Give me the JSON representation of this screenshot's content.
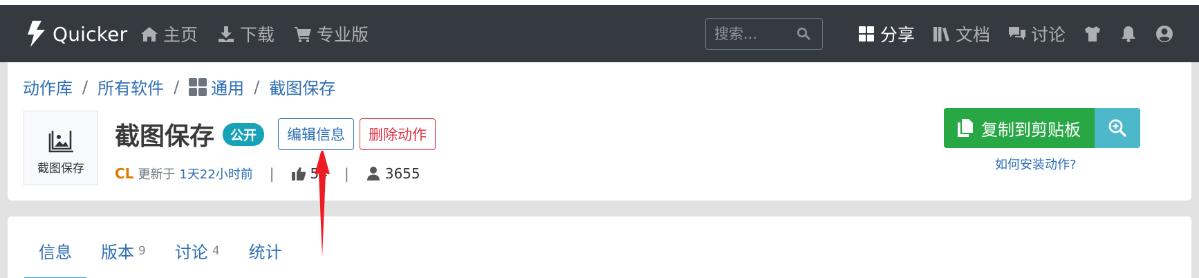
{
  "navbar": {
    "brand": "Quicker",
    "left_links": [
      {
        "label": "主页",
        "icon": "home-icon"
      },
      {
        "label": "下载",
        "icon": "download-icon"
      },
      {
        "label": "专业版",
        "icon": "cart-icon"
      }
    ],
    "search": {
      "placeholder": "搜索...",
      "value": ""
    },
    "right_links": [
      {
        "label": "分享",
        "icon": "grid-icon",
        "active": true
      },
      {
        "label": "文档",
        "icon": "books-icon"
      },
      {
        "label": "讨论",
        "icon": "comments-icon"
      }
    ],
    "icons": [
      "tshirt-icon",
      "bell-icon",
      "user-circle-icon"
    ]
  },
  "breadcrumb": [
    "动作库",
    "所有软件",
    "通用",
    "截图保存"
  ],
  "action": {
    "icon_caption": "截图保存",
    "title": "截图保存",
    "visibility_badge": "公开",
    "edit_button": "编辑信息",
    "delete_button": "删除动作",
    "author": "CL",
    "updated_prefix": "更新于",
    "updated_time": "1天22小时前",
    "likes": "54",
    "users": "3655",
    "copy_button": "复制到剪贴板",
    "howto_link": "如何安装动作?"
  },
  "tabs": [
    {
      "label": "信息",
      "count": "",
      "active": true
    },
    {
      "label": "版本",
      "count": "9"
    },
    {
      "label": "讨论",
      "count": "4"
    },
    {
      "label": "统计",
      "count": ""
    }
  ],
  "colors": {
    "navbar_bg": "#343a40",
    "link": "#2f6fb5",
    "badge": "#17a2b8",
    "copy_button": "#28a745",
    "zoom_button": "#4db8c9",
    "danger": "#dc3545",
    "author": "#e07b00",
    "tab_active": "#1ea0e6",
    "annotation_arrow": "#ee1c24"
  }
}
